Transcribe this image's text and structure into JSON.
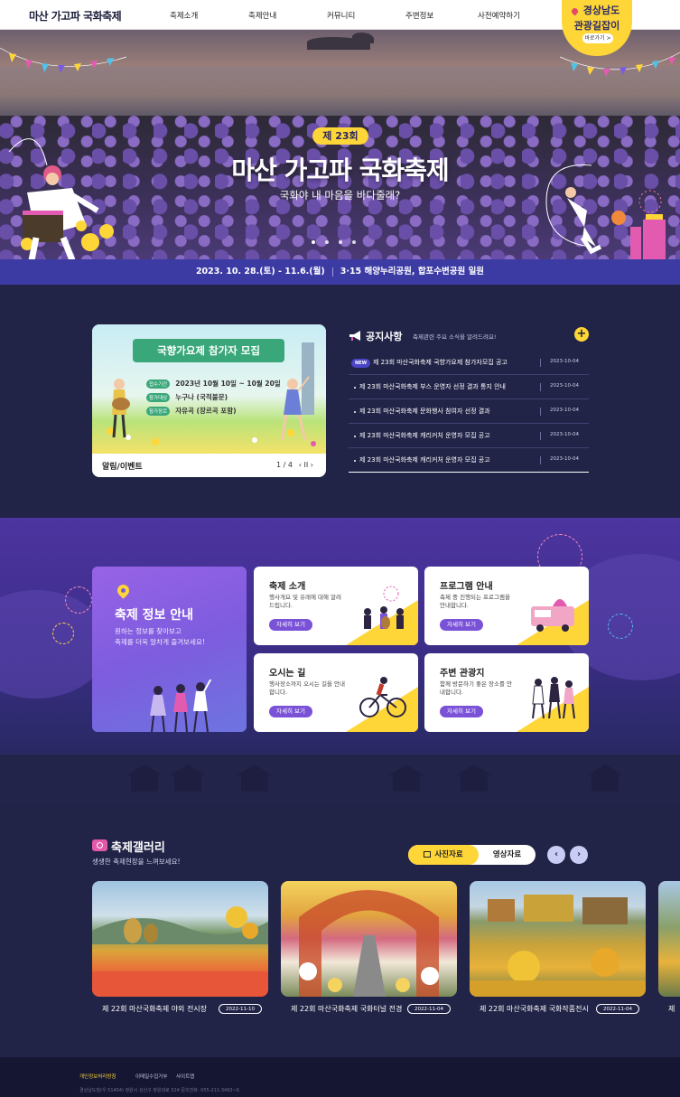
{
  "header": {
    "logo": "마산 가고파 국화축제",
    "nav": [
      "축제소개",
      "축제안내",
      "커뮤니티",
      "주변정보",
      "사전예약하기"
    ],
    "badge": {
      "line1": "경상남도",
      "line2": "관광길잡이",
      "go": "바로가기 >"
    }
  },
  "hero": {
    "edition": "제 23회",
    "title": "마산 가고파 국화축제",
    "subtitle": "국화야 내 마음을 바다줄래?",
    "slides_total": 4,
    "slide_active": 1
  },
  "datebar": {
    "dates": "2023. 10. 28.(토) - 11.6.(월)",
    "venue": "3·15 해양누리공원, 합포수변공원 일원"
  },
  "event": {
    "banner": "국향가요제 참가자 모집",
    "rows": [
      {
        "tag": "접수기간",
        "value": "2023년 10월 10일 ~ 10월 20일"
      },
      {
        "tag": "참가대상",
        "value": "누구나 (국적불문)"
      },
      {
        "tag": "참가장르",
        "value": "자유곡 (장르곡 포함)"
      }
    ],
    "label": "알림/이벤트",
    "pager": "1 / 4",
    "controls": "‹ II ›"
  },
  "notice": {
    "title": "공지사항",
    "desc": "축제관련 주요 소식을 알려드려요!",
    "plus": "+",
    "new_label": "NEW",
    "items": [
      {
        "text": "제 23회 마산국화축제 국향가요제 참가자모집 공고",
        "date": "2023-10-04",
        "is_new": true
      },
      {
        "text": "제 23회 마산국화축제 부스 운영자 선정 결과 통지 안내",
        "date": "2023-10-04",
        "is_new": false
      },
      {
        "text": "제 23회 마산국화축제 문화행사 참여자 선정 결과",
        "date": "2023-10-04",
        "is_new": false
      },
      {
        "text": "제 23회 마산국화축제 캐리커처 운영자 모집 공고",
        "date": "2023-10-04",
        "is_new": false
      },
      {
        "text": "제 23회 마산국화축제 캐리커처 운영자 모집 공고",
        "date": "2023-10-04",
        "is_new": false
      }
    ]
  },
  "info": {
    "main_title": "축제 정보 안내",
    "main_desc_1": "원하는 정보를 찾아보고",
    "main_desc_2": "축제를 더욱 알차게 즐겨보세요!",
    "btn_label": "자세히 보기",
    "cards": [
      {
        "title": "축제 소개",
        "desc": "행사개요 및 유래에 대해 알려드립니다."
      },
      {
        "title": "프로그램 안내",
        "desc": "축제 중 진행되는 프로그램을 안내합니다."
      },
      {
        "title": "오시는 길",
        "desc": "행사장소까지 오시는 길을 안내합니다."
      },
      {
        "title": "주변 관광지",
        "desc": "함께 방문하기 좋은 장소를 안내합니다."
      }
    ]
  },
  "gallery": {
    "title": "축제갤러리",
    "desc": "생생한 축제현장을 느껴보세요!",
    "tab_photo": "사진자료",
    "tab_video": "영상자료",
    "prev": "‹",
    "next": "›",
    "items": [
      {
        "caption": "제 22회 마산국화축제 야외 전시장",
        "date": "2022-11-10"
      },
      {
        "caption": "제 22회 마산국화축제 국화터널 전경",
        "date": "2022-11-04"
      },
      {
        "caption": "제 22회 마산국화축제 국화작품전시",
        "date": "2022-11-04"
      },
      {
        "caption": "제",
        "date": ""
      }
    ]
  },
  "footer": {
    "links": [
      "개인정보처리방침",
      "이메일수집거부",
      "사이트맵"
    ],
    "address": "경상남도청(우 51404) 창원시 성산구 창원대로 524 문의전화: 055-211-3493~6"
  },
  "colors": {
    "accent": "#ffd638",
    "primary": "#3c3aa3",
    "dark": "#222447",
    "purple": "#7a52d8"
  }
}
